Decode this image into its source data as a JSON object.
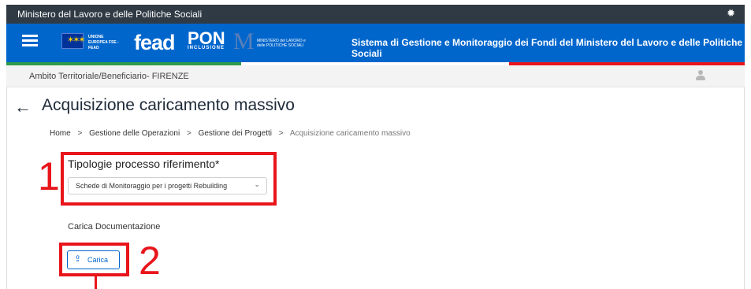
{
  "top_bar": {
    "title": "Ministero del Lavoro e delle Politiche Sociali",
    "settings_icon": "gear-icon"
  },
  "brand_bar": {
    "menu_icon": "hamburger-menu-icon",
    "eu_logo_text": "UNIONE EUROPEA FSE - FEAD",
    "fead_logo": "fead",
    "pon_logo": "PON",
    "pon_logo_sub": "INCLUSIONE",
    "ministry_logo_text": "MINISTERO del LAVORO e delle POLITICHE SOCIALI",
    "title": "Sistema di Gestione e Monitoraggio dei Fondi del Ministero del Lavoro e delle Politiche Sociali"
  },
  "context_bar": {
    "label": "Ambito Territoriale/Beneficiario- FIRENZE",
    "user_icon": "user-icon"
  },
  "page": {
    "back_icon": "arrow-left-icon",
    "title": "Acquisizione caricamento massivo",
    "breadcrumb": [
      "Home",
      "Gestione delle Operazioni",
      "Gestione dei Progetti",
      "Acquisizione caricamento massivo"
    ],
    "breadcrumb_separator": ">"
  },
  "form": {
    "process_type_label": "Tipologie processo riferimento*",
    "process_type_value": "Schede di Monitoraggio per i progetti Rebuilding",
    "upload_section_label": "Carica Documentazione",
    "upload_button_label": "Carica",
    "upload_icon": "upload-icon"
  },
  "annotations": {
    "step1": "1",
    "step2": "2",
    "highlight_color": "#e8151b"
  },
  "colors": {
    "brand_blue": "#0066cc",
    "top_bar": "#2f3a44",
    "flag_green": "#2e9a4a",
    "flag_red": "#e8151b"
  }
}
